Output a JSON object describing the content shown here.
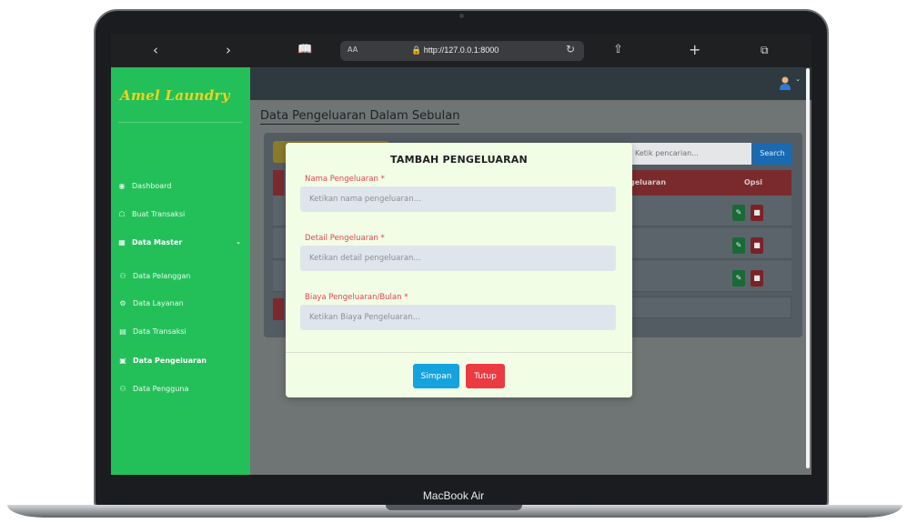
{
  "device": {
    "label": "MacBook Air"
  },
  "browser": {
    "url": "http://127.0.0.1:8000",
    "text_size_label": "AA",
    "icons": [
      "back-icon",
      "forward-icon",
      "bookmarks-icon",
      "lock-icon",
      "reload-icon",
      "share-icon",
      "new-tab-icon",
      "tabs-icon"
    ]
  },
  "app": {
    "brand": "Amel Laundry"
  },
  "sidebar": {
    "items": [
      {
        "label": "Dashboard",
        "icon": "dashboard-icon"
      },
      {
        "label": "Buat Transaksi",
        "icon": "cart-icon"
      },
      {
        "label": "Data Master",
        "icon": "table-icon"
      },
      {
        "label": "Data Pelanggan",
        "icon": "users-icon"
      },
      {
        "label": "Data Layanan",
        "icon": "service-icon"
      },
      {
        "label": "Data Transaksi",
        "icon": "transactions-icon"
      },
      {
        "label": "Data Pengeluaran",
        "icon": "money-icon"
      },
      {
        "label": "Data Pengguna",
        "icon": "user-group-icon"
      }
    ]
  },
  "page": {
    "title": "Data Pengeluaran Dalam Sebulan"
  },
  "table": {
    "search_placeholder": "Ketik pencarian...",
    "search_button": "Search",
    "headers": {
      "expense_partial": "geluaran",
      "options": "Opsi"
    }
  },
  "modal": {
    "title": "TAMBAH PENGELUARAN",
    "fields": [
      {
        "label": "Nama Pengeluaran *",
        "placeholder": "Ketikan nama pengeluaran..."
      },
      {
        "label": "Detail Pengeluaran *",
        "placeholder": "Ketikan detail pengeluaran..."
      },
      {
        "label": "Biaya Pengeluaran/Bulan *",
        "placeholder": "Ketikan Biaya Pengeluaran..."
      }
    ],
    "save_label": "Simpan",
    "close_label": "Tutup"
  },
  "colors": {
    "sidebar": "#23c05a",
    "brand": "#f2d21a",
    "modal_bg": "#f2fde6",
    "label_red": "#e0474a",
    "save_blue": "#14a3dd",
    "close_red": "#ec3a43"
  }
}
